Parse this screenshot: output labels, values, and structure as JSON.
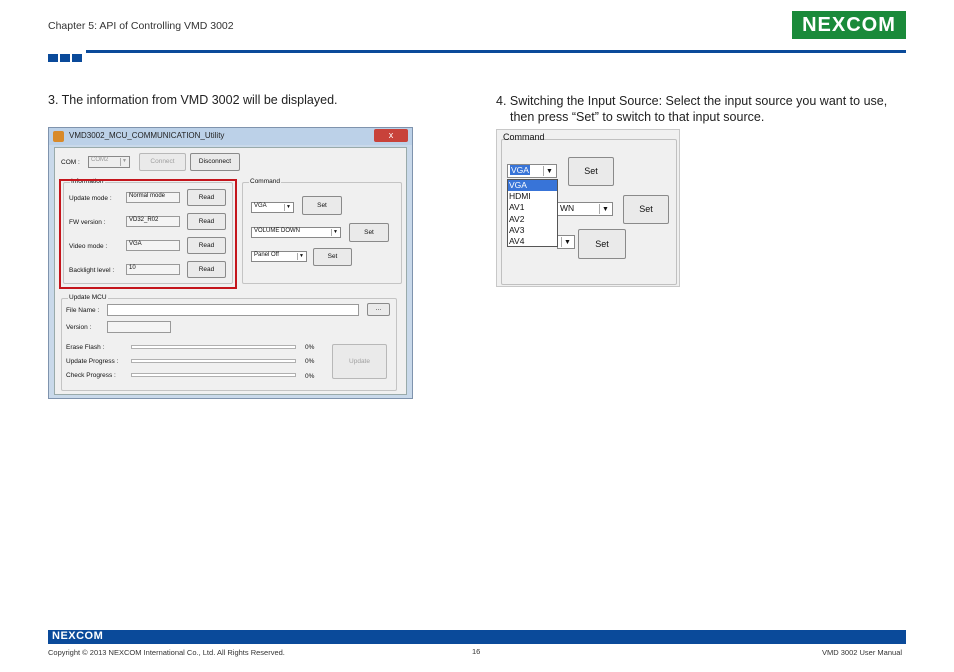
{
  "header": {
    "chapter": "Chapter 5: API of Controlling VMD 3002",
    "logo": "NEXCOM"
  },
  "text": {
    "step3": "3. The information from VMD 3002 will be displayed.",
    "step4_line1": "4. Switching the Input Source: Select the input source you want to use,",
    "step4_line2": "then press “Set” to switch to that input source."
  },
  "window": {
    "title": "VMD3002_MCU_COMMUNICATION_Utility",
    "close_label": "x",
    "com_label": "COM :",
    "com_value": "COM2",
    "connect_label": "Connect",
    "disconnect_label": "Disconnect",
    "information": {
      "caption": "Information",
      "rows": [
        {
          "label": "Update mode :",
          "value": "Normal mode",
          "button": "Read"
        },
        {
          "label": "FW version :",
          "value": "VD32_R02",
          "button": "Read"
        },
        {
          "label": "Video mode :",
          "value": "VGA",
          "button": "Read"
        },
        {
          "label": "Backlight level :",
          "value": "10",
          "button": "Read"
        }
      ]
    },
    "command": {
      "caption": "Command",
      "rows": [
        {
          "value": "VGA",
          "button": "Set"
        },
        {
          "value": "VOLUME DOWN",
          "button": "Set"
        },
        {
          "value": "Panel Off",
          "button": "Set"
        }
      ]
    },
    "update": {
      "caption": "Update MCU",
      "file_label": "File Name :",
      "browse_label": "...",
      "version_label": "Version :",
      "erase_label": "Erase Flash :",
      "progress_label": "Update Progress :",
      "check_label": "Check Progress :",
      "erase_pct": "0%",
      "progress_pct": "0%",
      "check_pct": "0%",
      "update_button": "Update"
    }
  },
  "command_panel": {
    "caption": "Command",
    "combo_value": "VGA",
    "partial_value": "WN",
    "set_label": "Set",
    "options": [
      "VGA",
      "HDMI",
      "AV1",
      "AV2",
      "AV3",
      "AV4"
    ],
    "selected_option": "VGA"
  },
  "footer": {
    "logo": "NEXCOM",
    "copyright": "Copyright © 2013 NEXCOM International Co., Ltd. All Rights Reserved.",
    "page": "16",
    "manual": "VMD 3002 User Manual"
  },
  "colors": {
    "brand_blue": "#0a4a9a",
    "logo_green": "#1a8a3a",
    "highlight_red": "#c4151c"
  }
}
